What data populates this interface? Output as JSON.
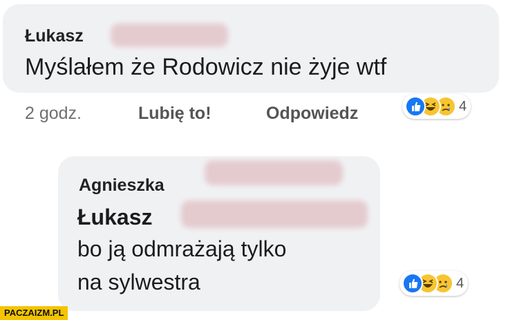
{
  "comment1": {
    "author": "Łukasz",
    "text": "Myślałem że Rodowicz nie żyje wtf",
    "time": "2 godz.",
    "like_label": "Lubię to!",
    "reply_label": "Odpowiedz",
    "reaction_count": "4",
    "reactions": [
      "like-icon",
      "haha-icon",
      "sad-icon"
    ]
  },
  "comment2": {
    "author": "Agnieszka",
    "mention": "Łukasz",
    "text_line1": "bo ją odmrażają tylko",
    "text_line2": "na sylwestra",
    "reaction_count": "4",
    "reactions": [
      "like-icon",
      "haha-icon",
      "sad-icon"
    ]
  },
  "watermark": "PACZAIZM.PL",
  "colors": {
    "bubble": "#f0f1f3",
    "like": "#1877f2",
    "emoji": "#f7c531",
    "watermark_bg": "#f4c400"
  }
}
